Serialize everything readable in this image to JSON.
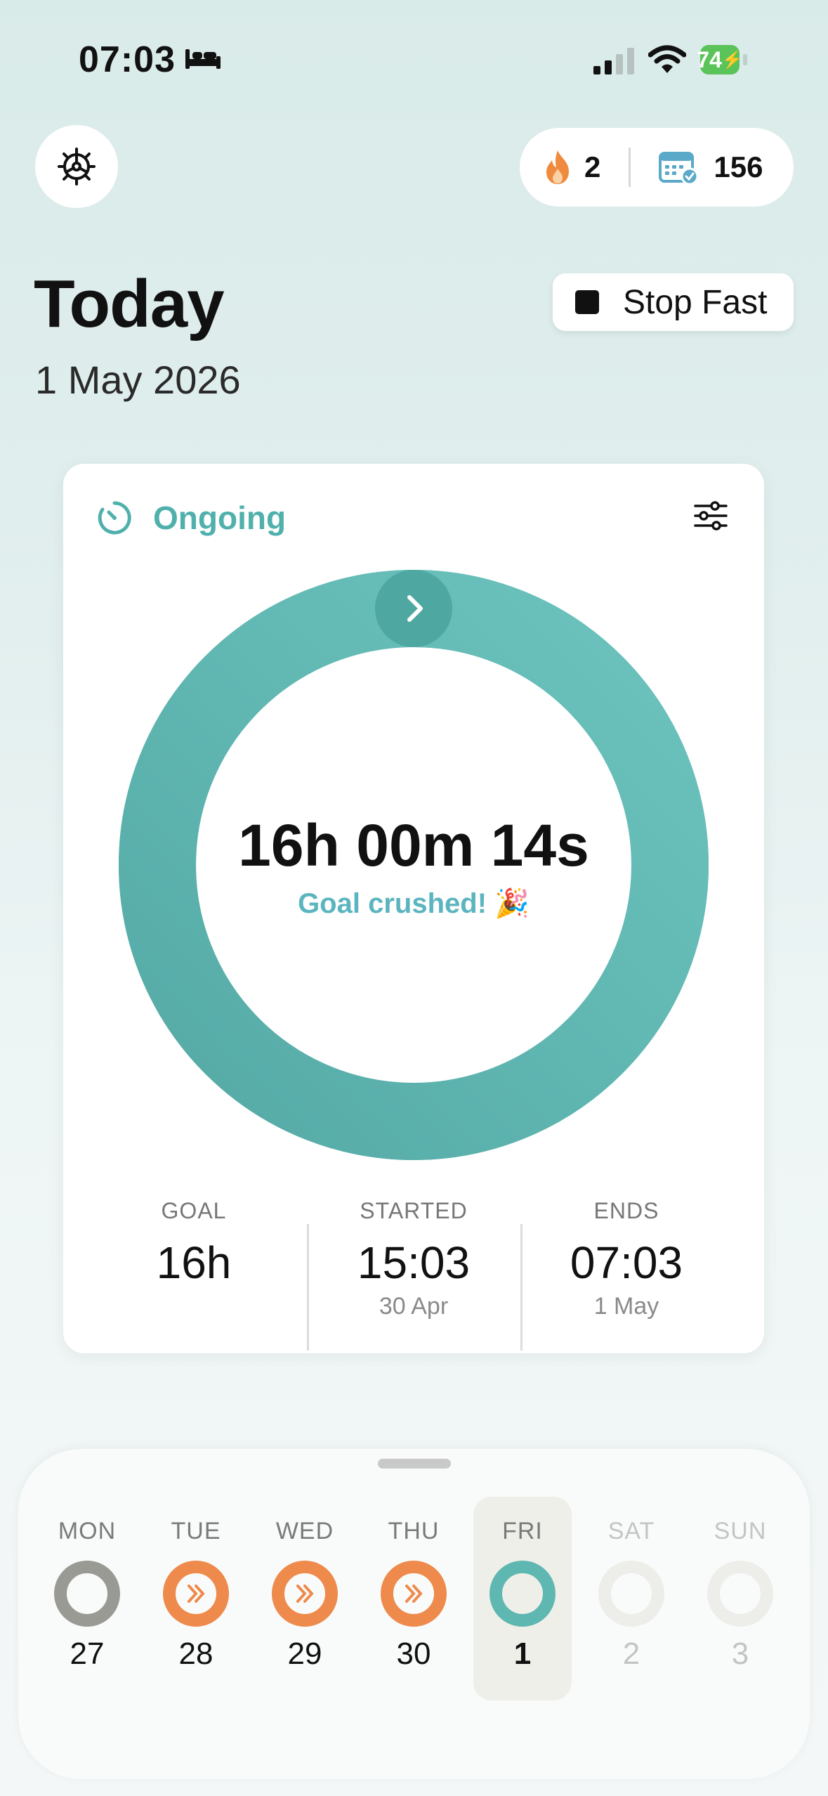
{
  "status_bar": {
    "time": "07:03",
    "battery": "74"
  },
  "header": {
    "streak_count": "2",
    "total_fasts": "156"
  },
  "page": {
    "title": "Today",
    "date": "1 May 2026",
    "stop_button_label": "Stop Fast"
  },
  "fast_card": {
    "status": "Ongoing",
    "elapsed": "16h 00m 14s",
    "message": "Goal crushed! 🎉",
    "progress_fraction": 1.0,
    "stats": [
      {
        "label": "GOAL",
        "value": "16h",
        "sub": ""
      },
      {
        "label": "STARTED",
        "value": "15:03",
        "sub": "30 Apr"
      },
      {
        "label": "ENDS",
        "value": "07:03",
        "sub": "1 May"
      }
    ]
  },
  "week": {
    "days": [
      {
        "name": "MON",
        "number": "27",
        "state": "partial"
      },
      {
        "name": "TUE",
        "number": "28",
        "state": "exceeded"
      },
      {
        "name": "WED",
        "number": "29",
        "state": "exceeded"
      },
      {
        "name": "THU",
        "number": "30",
        "state": "exceeded"
      },
      {
        "name": "FRI",
        "number": "1",
        "state": "ongoing"
      },
      {
        "name": "SAT",
        "number": "2",
        "state": "future"
      },
      {
        "name": "SUN",
        "number": "3",
        "state": "future"
      }
    ]
  },
  "colors": {
    "accent_teal": "#5fb7b2",
    "exceeded_orange": "#ee8a4c",
    "partial_gray": "#9a9a94"
  }
}
